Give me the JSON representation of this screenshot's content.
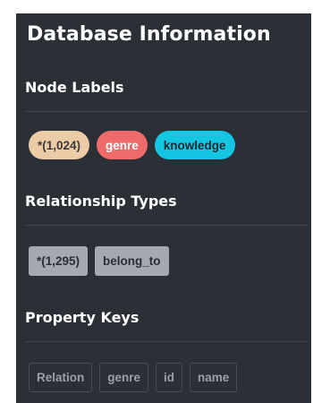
{
  "panel": {
    "title": "Database Information"
  },
  "node_labels": {
    "heading": "Node Labels",
    "items": [
      {
        "label": "*(1,024)",
        "color": "#eccca7"
      },
      {
        "label": "genre",
        "color": "#ef6b6b"
      },
      {
        "label": "knowledge",
        "color": "#14c6e2"
      }
    ]
  },
  "relationship_types": {
    "heading": "Relationship Types",
    "items": [
      {
        "label": "*(1,295)"
      },
      {
        "label": "belong_to"
      }
    ]
  },
  "property_keys": {
    "heading": "Property Keys",
    "items": [
      {
        "label": "Relation"
      },
      {
        "label": "genre"
      },
      {
        "label": "id"
      },
      {
        "label": "name"
      }
    ]
  },
  "colors": {
    "panel_background": "#2b2f36",
    "relationship_tag": "#a4a9b2",
    "property_border": "#484d56"
  }
}
